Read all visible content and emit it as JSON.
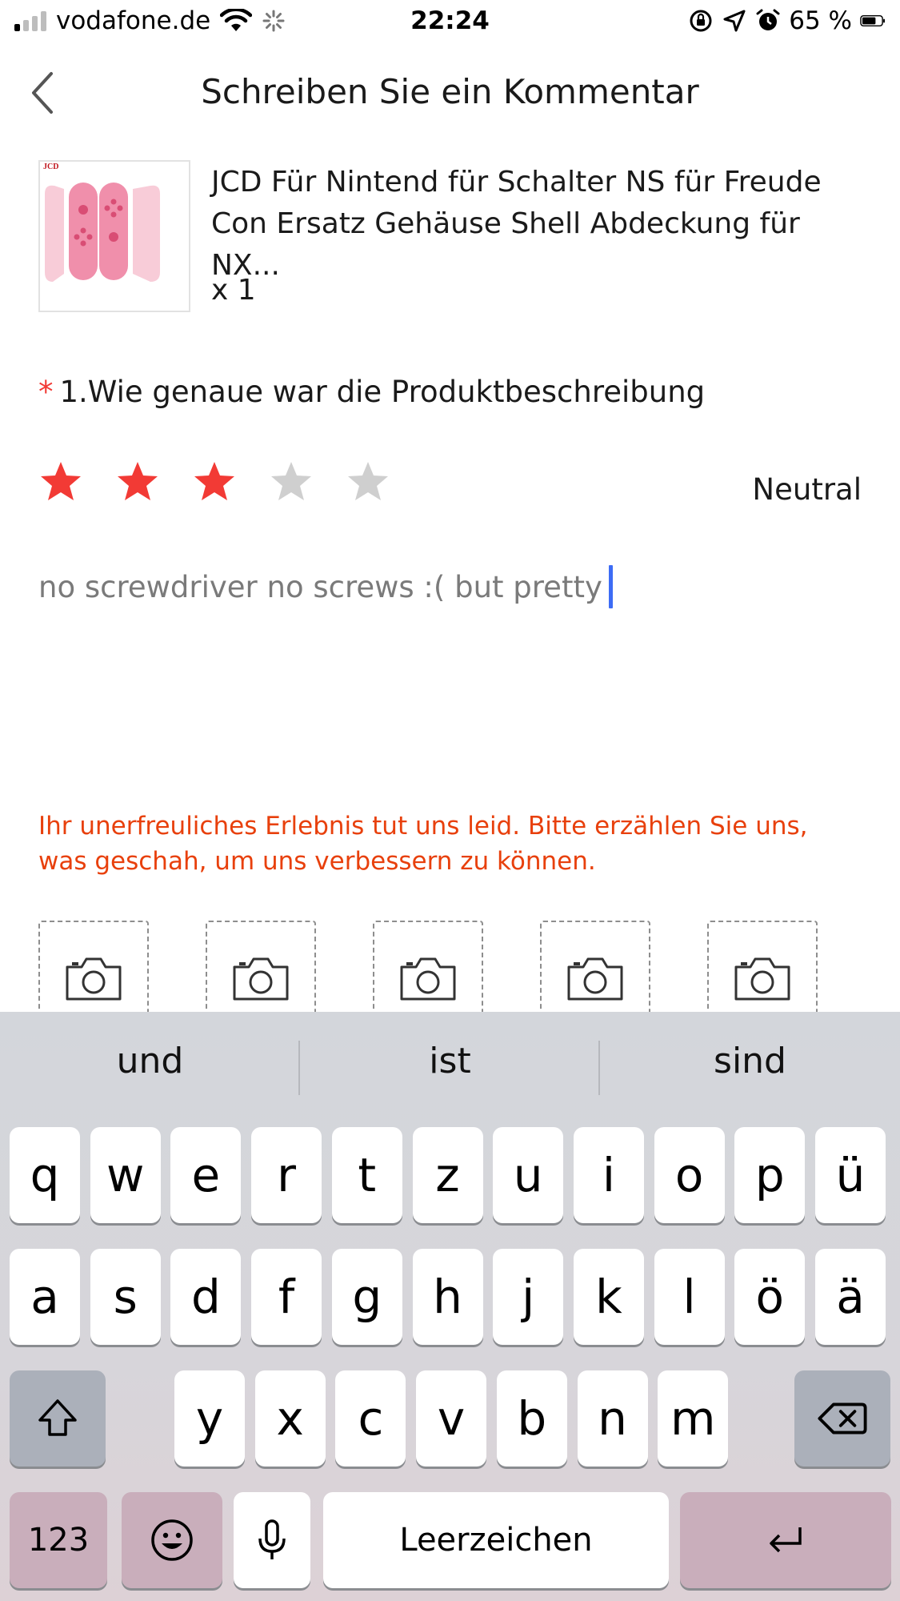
{
  "status_bar": {
    "carrier": "vodafone.de",
    "time": "22:24",
    "battery_percent": "65 %"
  },
  "nav": {
    "title": "Schreiben Sie ein Kommentar"
  },
  "product": {
    "title": "JCD Für Nintend für Schalter NS für Freude Con Ersatz Gehäuse Shell Abdeckung für NX...",
    "quantity": "x 1",
    "thumb_brand": "JCD"
  },
  "question": {
    "required_mark": "*",
    "text": "1.Wie genaue war die Produktbeschreibung",
    "rating": 3,
    "max_rating": 5,
    "rating_label": "Neutral"
  },
  "comment": {
    "value": "no screwdriver no screws :( but pretty"
  },
  "notice": "Ihr unerfreuliches Erlebnis tut uns leid. Bitte erzählen Sie uns, was geschah, um uns verbessern zu können.",
  "photo_slots": 5,
  "keyboard": {
    "suggestions": [
      "und",
      "ist",
      "sind"
    ],
    "row1": [
      "q",
      "w",
      "e",
      "r",
      "t",
      "z",
      "u",
      "i",
      "o",
      "p",
      "ü"
    ],
    "row2": [
      "a",
      "s",
      "d",
      "f",
      "g",
      "h",
      "j",
      "k",
      "l",
      "ö",
      "ä"
    ],
    "row3": [
      "y",
      "x",
      "c",
      "v",
      "b",
      "n",
      "m"
    ],
    "numbers_label": "123",
    "space_label": "Leerzeichen"
  },
  "colors": {
    "star_active": "#f23a35",
    "star_inactive": "#cfcfcf",
    "notice": "#e8400c",
    "caret": "#3d6cf5"
  }
}
